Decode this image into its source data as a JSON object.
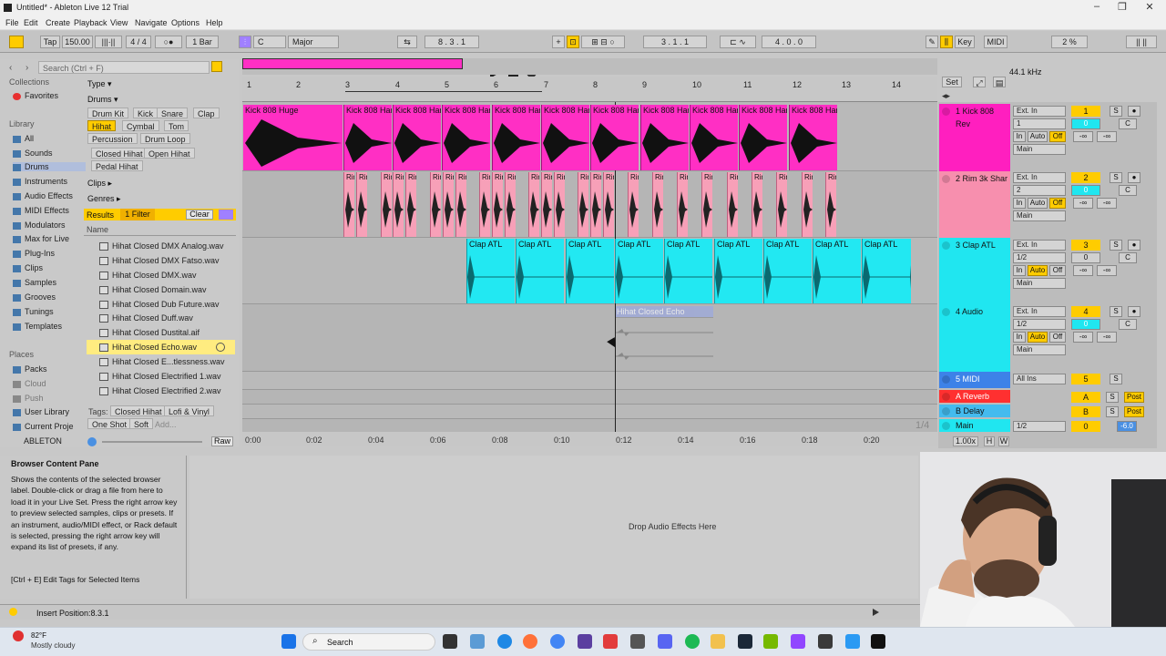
{
  "window": {
    "title": "Untitled* - Ableton Live 12 Trial"
  },
  "menu": [
    "File",
    "Edit",
    "Create",
    "Playback",
    "View",
    "Navigate",
    "Options",
    "Help"
  ],
  "control_bar": {
    "tap": "Tap",
    "tempo": "150.00",
    "time_sig": "4 / 4",
    "quantize": "1 Bar",
    "key": "C",
    "scale": "Major",
    "position": "8 . 3 . 1",
    "loop_start": "3 . 1 . 1",
    "loop_length": "4 . 0 . 0",
    "key_btn": "Key",
    "midi_btn": "MIDI",
    "sample_rate": "44.1 kHz",
    "cpu": "2 %"
  },
  "browser": {
    "search_placeholder": "Search (Ctrl + F)",
    "collections_header": "Collections",
    "favorites": "Favorites",
    "library_header": "Library",
    "library_items": [
      "All",
      "Sounds",
      "Drums",
      "Instruments",
      "Audio Effects",
      "MIDI Effects",
      "Modulators",
      "Max for Live",
      "Plug-Ins",
      "Clips",
      "Samples",
      "Grooves",
      "Tunings",
      "Templates"
    ],
    "places_header": "Places",
    "places_items": [
      "Packs",
      "Cloud",
      "Push",
      "User Library",
      "Current Proje",
      "ABLETON"
    ],
    "filters": {
      "type_label": "Type",
      "type_value": "Drums",
      "drum_row1": [
        "Drum Kit",
        "Kick",
        "Snare",
        "Clap"
      ],
      "drum_row2": [
        "Hihat",
        "Cymbal",
        "Tom"
      ],
      "drum_row3": [
        "Percussion",
        "Drum Loop"
      ],
      "hihat_row1": [
        "Closed Hihat",
        "Open Hihat"
      ],
      "hihat_row2": [
        "Pedal Hihat"
      ],
      "clips_label": "Clips",
      "genres_label": "Genres"
    },
    "results_label": "Results",
    "filter_count": "1 Filter",
    "clear": "Clear",
    "name_header": "Name",
    "files": [
      "Hihat Closed DMX Analog.wav",
      "Hihat Closed DMX Fatso.wav",
      "Hihat Closed DMX.wav",
      "Hihat Closed Domain.wav",
      "Hihat Closed Dub Future.wav",
      "Hihat Closed Duff.wav",
      "Hihat Closed Dustital.aif",
      "Hihat Closed Echo.wav",
      "Hihat Closed E...tlessness.wav",
      "Hihat Closed Electrified 1.wav",
      "Hihat Closed Electrified 2.wav"
    ],
    "selected_file_index": 7,
    "tags_label": "Tags:",
    "tags": [
      "Closed Hihat",
      "Lofi & Vinyl"
    ],
    "tags2": [
      "One Shot",
      "Soft",
      "Add..."
    ],
    "raw": "Raw"
  },
  "ruler": {
    "bars": [
      "1",
      "2",
      "3",
      "4",
      "5",
      "6",
      "7",
      "8",
      "9",
      "10",
      "11",
      "12",
      "13",
      "14"
    ]
  },
  "tracks": [
    {
      "name": "1 Kick 808 Rev",
      "num": "1",
      "input": "Ext. In",
      "channel": "1",
      "color": "#ff1fbf",
      "clip_color": "#ff2fc4",
      "first_clip": "Kick 808 Huge",
      "clip_label": "Kick 808 Har"
    },
    {
      "name": "2 Rim 3k Shar",
      "num": "2",
      "input": "Ext. In",
      "channel": "2",
      "color": "#f78fae",
      "clip_color": "#f7a0b8",
      "clip_label": "Rim"
    },
    {
      "name": "3 Clap ATL",
      "num": "3",
      "input": "Ext. In",
      "channel": "1/2",
      "color": "#20e6f0",
      "clip_color": "#22e8f2",
      "clip_label": "Clap ATL"
    },
    {
      "name": "4 Audio",
      "num": "4",
      "input": "Ext. In",
      "channel": "1/2",
      "color": "#20e6f0",
      "preview_clip": "Hihat Closed Echo"
    },
    {
      "name": "5 MIDI",
      "num": "5",
      "input": "All Ins",
      "color": "#3d82e8"
    },
    {
      "name": "A Reverb",
      "num": "A",
      "color": "#ff3030"
    },
    {
      "name": "B Delay",
      "num": "B",
      "color": "#44bbee"
    },
    {
      "name": "Main",
      "num": "0",
      "channel": "1/2",
      "color": "#20e6f0",
      "volume": "-6.0"
    }
  ],
  "mixer_labels": {
    "in": "In",
    "auto": "Auto",
    "off": "Off",
    "main": "Main",
    "s": "S",
    "post": "Post",
    "neg_inf": "-∞",
    "c": "C",
    "zero": "0"
  },
  "ratio": "1/4",
  "zoom": "1.00x",
  "timeline": [
    "0:00",
    "0:02",
    "0:04",
    "0:06",
    "0:08",
    "0:10",
    "0:12",
    "0:14",
    "0:16",
    "0:18",
    "0:20"
  ],
  "info": {
    "title": "Browser Content Pane",
    "body": "Shows the contents of the selected browser label. Double-click or drag a file from here to load it in your Live Set. Press the right arrow key to preview selected samples, clips or presets. If an instrument, audio/MIDI effect, or Rack default is selected, pressing the right arrow key will expand its list of presets, if any.",
    "shortcut": "[Ctrl + E] Edit Tags for Selected Items"
  },
  "drop_text": "Drop Audio Effects Here",
  "status": "Insert Position:8.3.1",
  "taskbar": {
    "temp": "82°F",
    "weather": "Mostly cloudy",
    "search": "Search"
  }
}
